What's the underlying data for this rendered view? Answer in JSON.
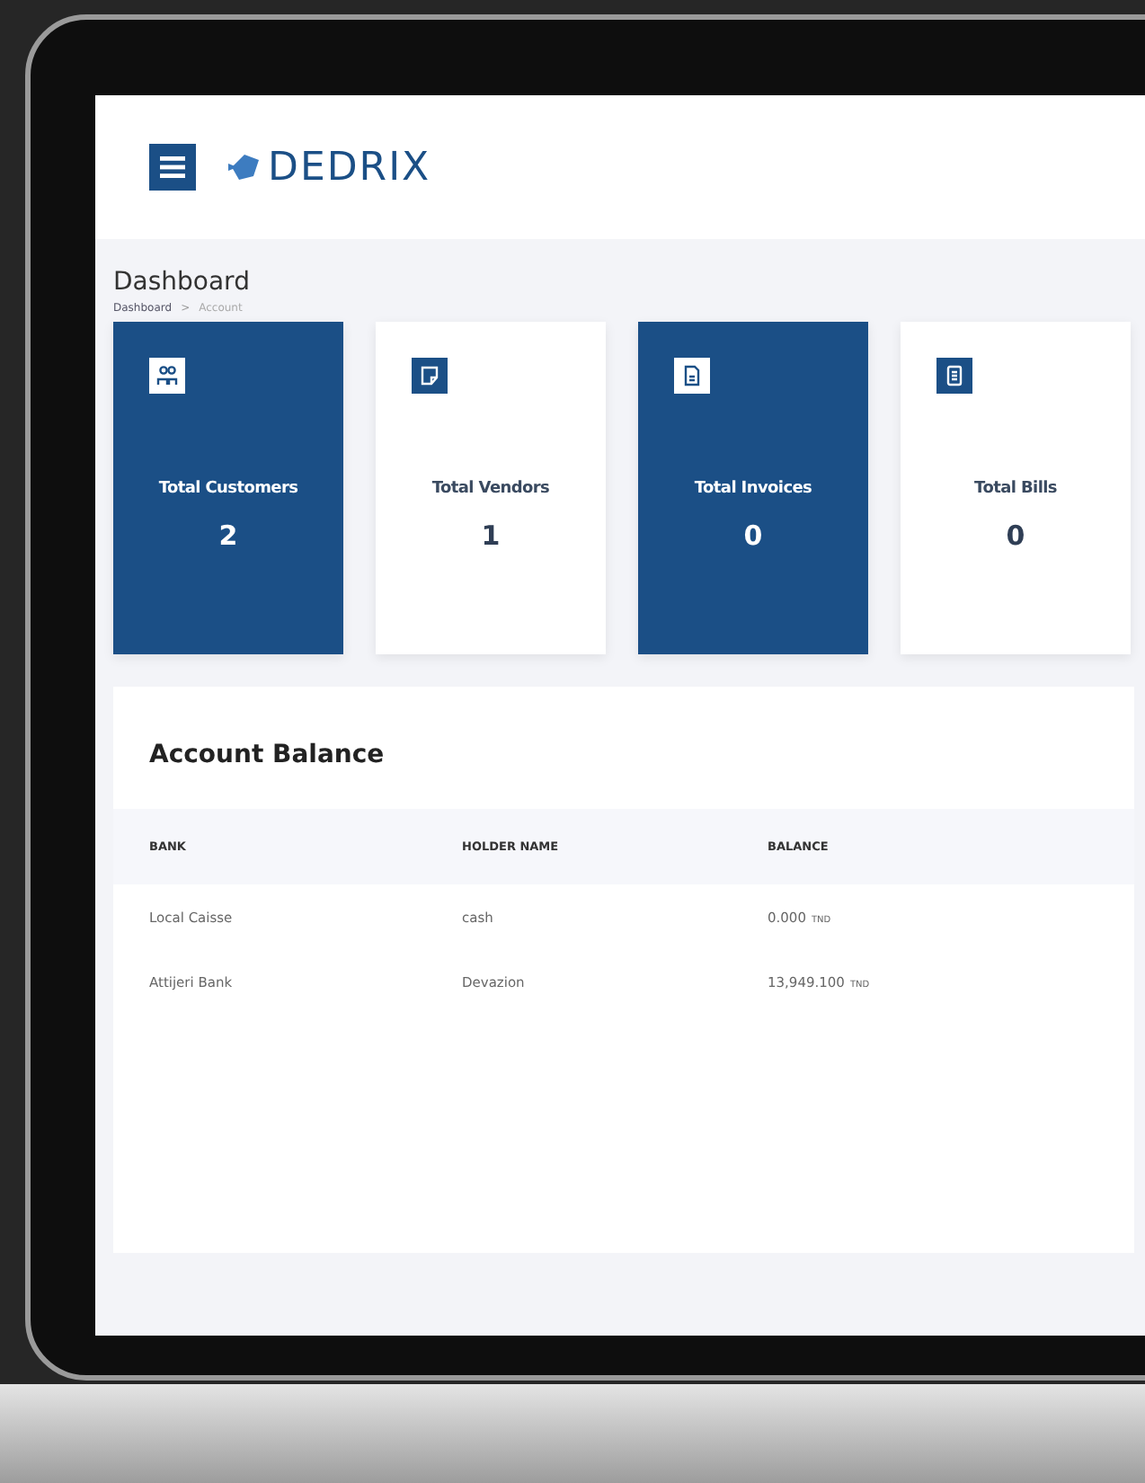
{
  "brand": {
    "name": "DEDRIX"
  },
  "page": {
    "title": "Dashboard",
    "breadcrumb": [
      "Dashboard",
      "Account"
    ],
    "separator": ">"
  },
  "stats": [
    {
      "label": "Total Customers",
      "value": "2",
      "highlighted": true,
      "kind": "users"
    },
    {
      "label": "Total Vendors",
      "value": "1",
      "highlighted": false,
      "kind": "note"
    },
    {
      "label": "Total Invoices",
      "value": "0",
      "highlighted": true,
      "kind": "file"
    },
    {
      "label": "Total Bills",
      "value": "0",
      "highlighted": false,
      "kind": "bill"
    }
  ],
  "account_balance": {
    "title": "Account Balance",
    "columns": [
      "BANK",
      "HOLDER NAME",
      "BALANCE"
    ],
    "rows": [
      {
        "bank": "Local Caisse",
        "holder": "cash",
        "balance": "0.000",
        "currency": "TND"
      },
      {
        "bank": "Attijeri Bank",
        "holder": "Devazion",
        "balance": "13,949.100",
        "currency": "TND"
      }
    ]
  }
}
